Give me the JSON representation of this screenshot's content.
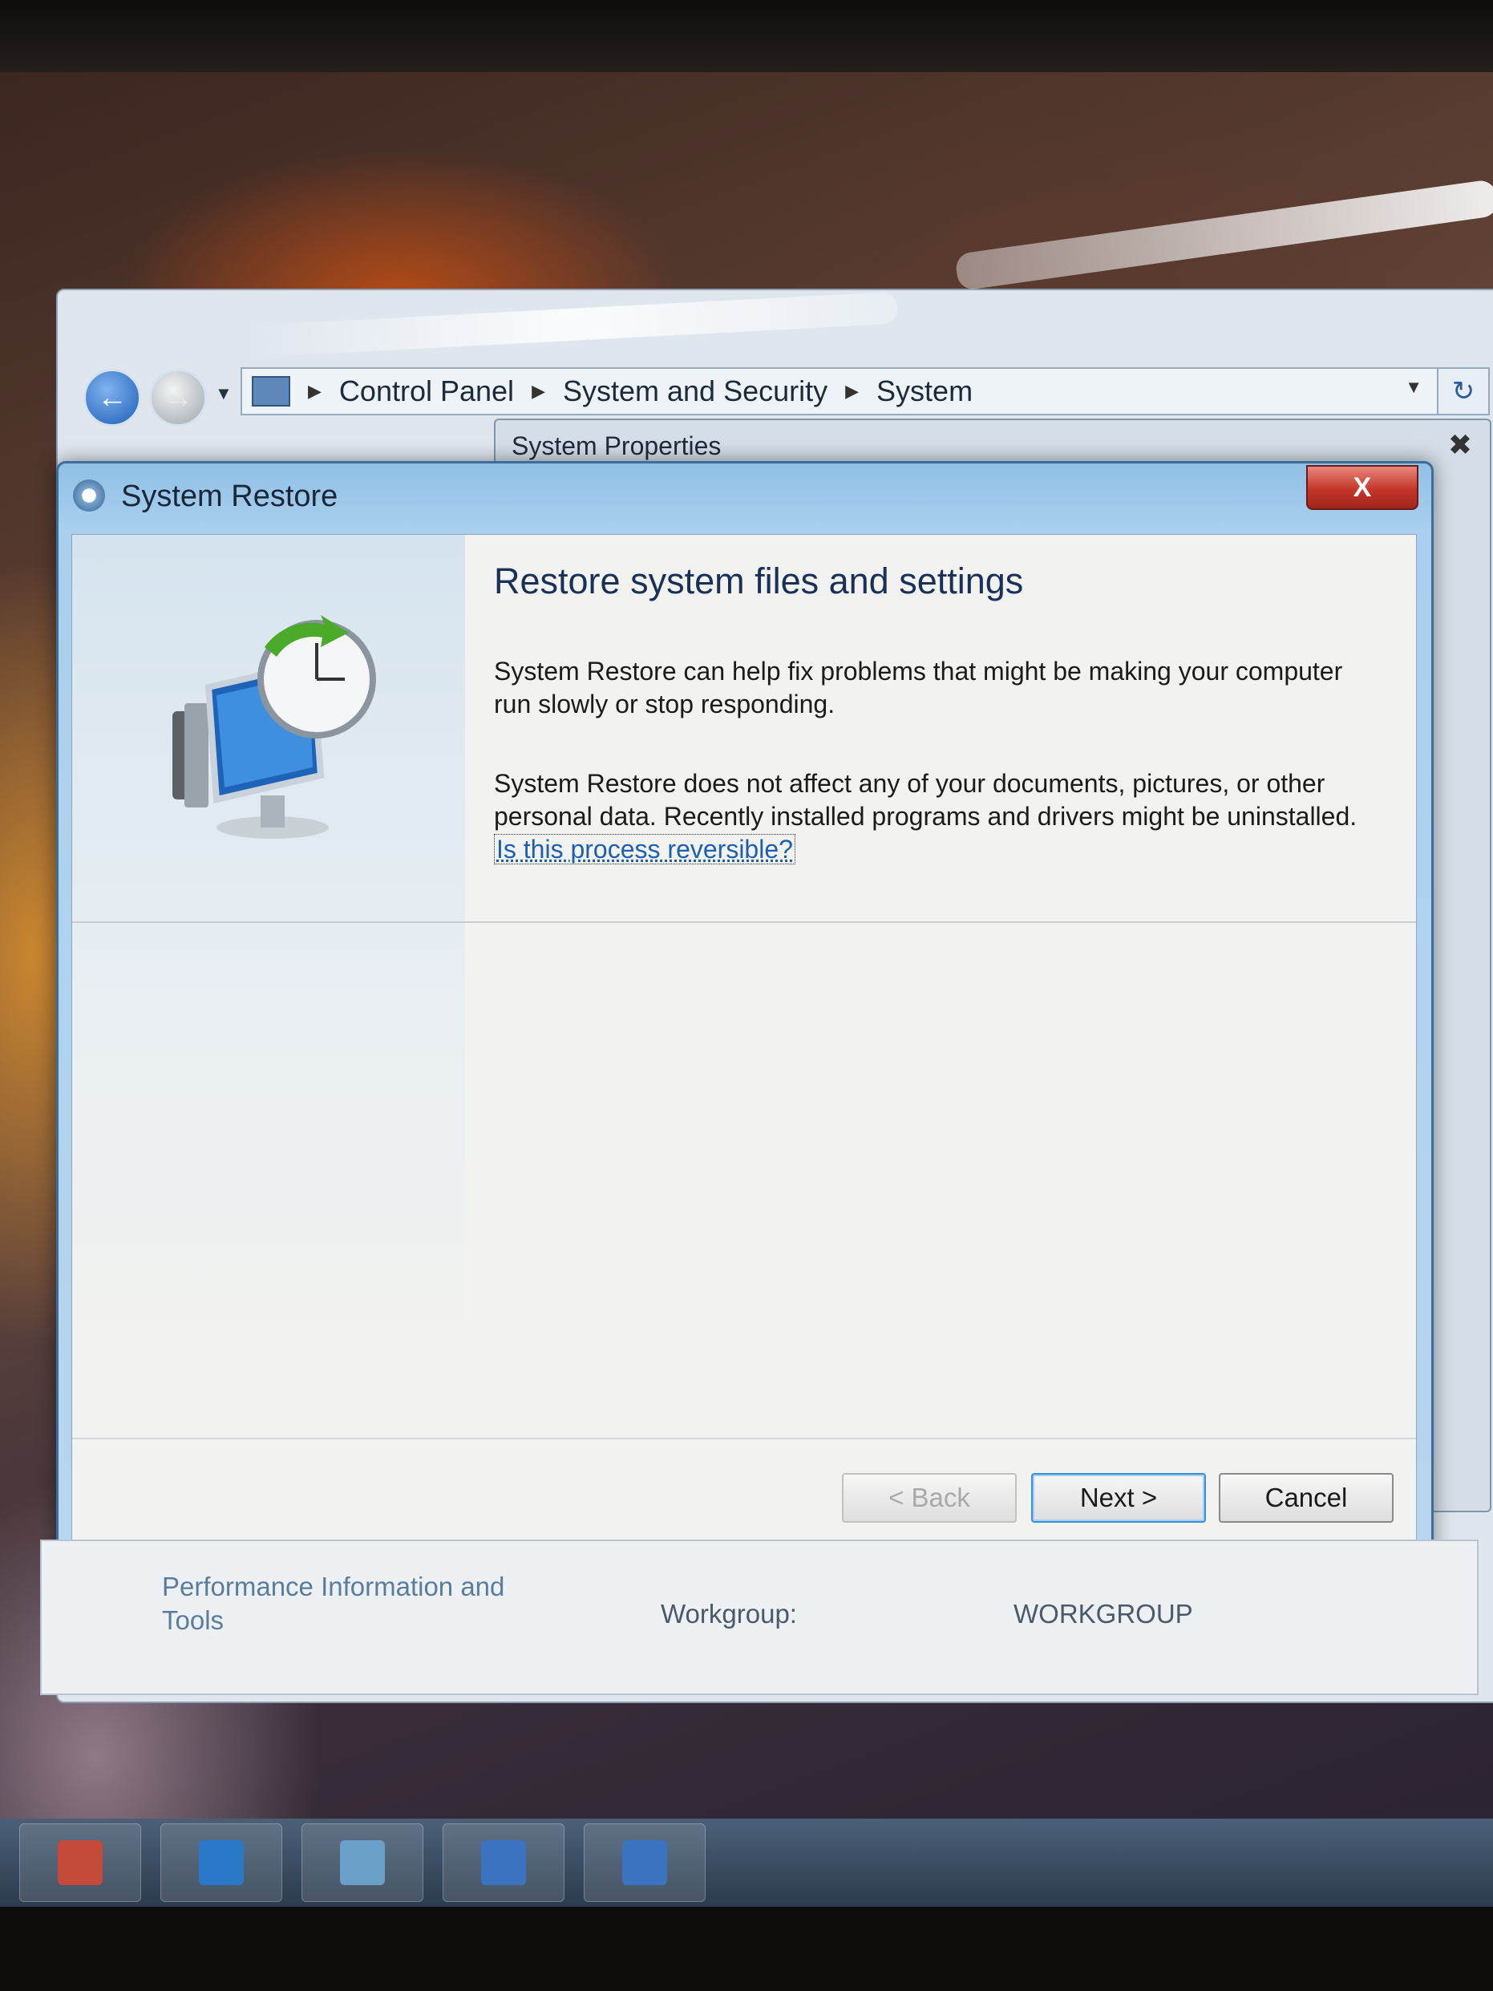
{
  "explorer": {
    "breadcrumb": [
      "Control Panel",
      "System and Security",
      "System"
    ],
    "perf_link": "Performance Information and Tools",
    "workgroup_label": "Workgroup:",
    "workgroup_value": "WORKGROUP"
  },
  "system_properties": {
    "title": "System Properties"
  },
  "dialog": {
    "title": "System Restore",
    "close_label": "X",
    "heading": "Restore system files and settings",
    "para1": "System Restore can help fix problems that might be making your computer run slowly or stop responding.",
    "para2": "System Restore does not affect any of your documents, pictures, or other personal data. Recently installed programs and drivers might be uninstalled.",
    "link": "Is this process reversible?",
    "buttons": {
      "back": "< Back",
      "next": "Next >",
      "cancel": "Cancel"
    }
  },
  "taskbar": {
    "items": [
      "app-icon",
      "outlook-icon",
      "app-icon",
      "app-icon",
      "app-icon"
    ],
    "colors": [
      "#c44a3a",
      "#2a78c8",
      "#6aa0c8",
      "#3a74c0",
      "#3a74c0"
    ]
  }
}
